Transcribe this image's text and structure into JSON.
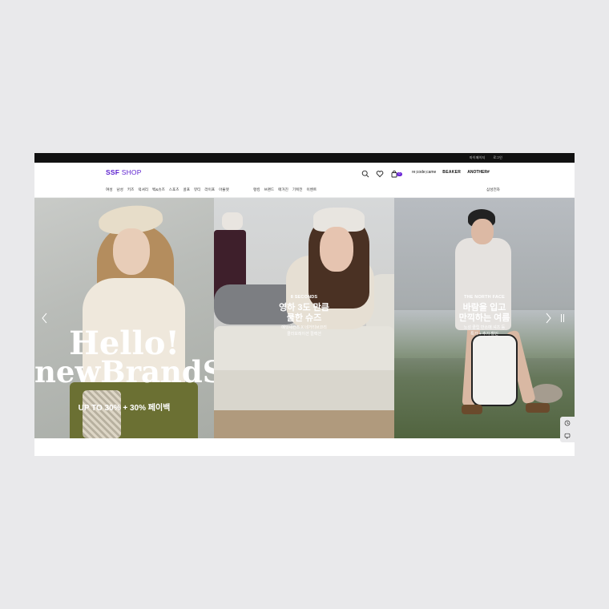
{
  "topbar": {
    "mypage": "마이페이지",
    "login": "로그인"
  },
  "header": {
    "logo_bold": "SSF",
    "logo_rest": " SHOP",
    "cart_count": "0",
    "brands": [
      "re;code;came",
      "BEAKER",
      "ANOTHER#"
    ]
  },
  "nav": {
    "categories": [
      "여성",
      "남성",
      "키즈",
      "럭셔리",
      "백&슈즈",
      "스포츠",
      "골프",
      "뷰티",
      "라이프",
      "아울렛"
    ],
    "menu": [
      "랭킹",
      "브랜드",
      "매거진",
      "기획전",
      "이벤트"
    ],
    "right": "삼성전자"
  },
  "hero": {
    "panel1": {
      "line1": "Hello!",
      "line2": "newBrandS",
      "promo": "UP TO 30% + 30% 페이백"
    },
    "panel2": {
      "brand": "8 SECONDS",
      "head1": "영하 3도 만큼",
      "head2": "쿨한 슈즈",
      "sub1": "에잇세컨즈 X 네거티브코리",
      "sub2": "콜라보레이션 컬렉션"
    },
    "panel3": {
      "brand": "THE NORTH FACE",
      "head1": "바람을 입고",
      "head2": "만끽하는 여름",
      "sub1": "노성 클립 반소매 셔츠 등",
      "sub2": "특가 + 추가 할인"
    }
  },
  "colors": {
    "brand": "#5b1ecf",
    "badge": "#6b25d6",
    "topbar": "#111111"
  },
  "icons": [
    "search-icon",
    "heart-icon",
    "cart-icon",
    "chevron-left-icon",
    "chevron-right-icon",
    "pause-icon",
    "recent-icon",
    "chat-icon"
  ]
}
